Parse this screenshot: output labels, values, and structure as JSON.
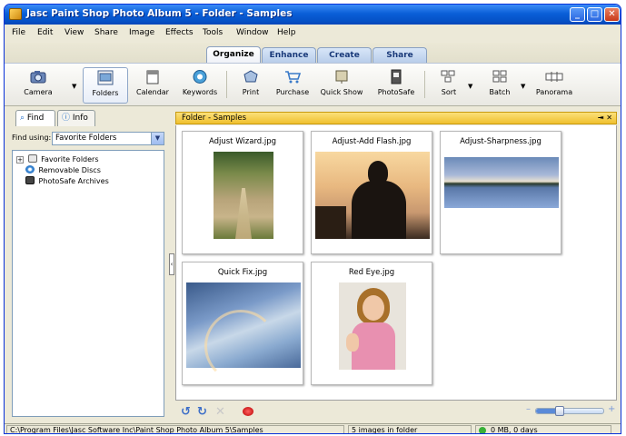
{
  "window": {
    "title": "Jasc Paint Shop Photo Album 5 - Folder - Samples",
    "min": "_",
    "max": "□",
    "close": "✕"
  },
  "menu": [
    "File",
    "Edit",
    "View",
    "Share",
    "Image",
    "Effects",
    "Tools",
    "Window",
    "Help"
  ],
  "main_tabs": [
    {
      "label": "Organize",
      "active": true
    },
    {
      "label": "Enhance"
    },
    {
      "label": "Create"
    },
    {
      "label": "Share"
    }
  ],
  "toolbar": [
    {
      "label": "Camera",
      "icon": "camera-icon"
    },
    {
      "label": "Folders",
      "icon": "folders-icon",
      "selected": true
    },
    {
      "label": "Calendar",
      "icon": "calendar-icon"
    },
    {
      "label": "Keywords",
      "icon": "keywords-icon"
    },
    {
      "label": "Print",
      "icon": "print-icon"
    },
    {
      "label": "Purchase",
      "icon": "cart-icon"
    },
    {
      "label": "Quick Show",
      "icon": "quickshow-icon"
    },
    {
      "label": "PhotoSafe",
      "icon": "photosafe-icon"
    },
    {
      "label": "Sort",
      "icon": "sort-icon"
    },
    {
      "label": "Batch",
      "icon": "batch-icon"
    },
    {
      "label": "Panorama",
      "icon": "panorama-icon"
    }
  ],
  "left_panel": {
    "tabs": [
      {
        "label": "Find",
        "active": true
      },
      {
        "label": "Info"
      }
    ],
    "find_label": "Find using:",
    "find_value": "Favorite Folders",
    "tree": [
      {
        "label": "Favorite Folders",
        "expander": "+"
      },
      {
        "label": "Removable Discs"
      },
      {
        "label": "PhotoSafe Archives"
      }
    ]
  },
  "folder_panel": {
    "title": "Folder - Samples",
    "pin": "⇥",
    "close": "✕"
  },
  "thumbnails": [
    {
      "caption": "Adjust Wizard.jpg"
    },
    {
      "caption": "Adjust-Add Flash.jpg"
    },
    {
      "caption": "Adjust-Sharpness.jpg"
    },
    {
      "caption": "Quick Fix.jpg"
    },
    {
      "caption": "Red Eye.jpg"
    }
  ],
  "zoom_level": 0.35,
  "status": {
    "path": "C:\\Program Files\\Jasc Software Inc\\Paint Shop Photo Album 5\\Samples",
    "count": "5 images in folder",
    "safe": "0 MB, 0 days"
  },
  "colors": {
    "titlebar": "#0a5fd8",
    "folder_header": "#f0c02e",
    "accent": "#3c6ec8"
  }
}
